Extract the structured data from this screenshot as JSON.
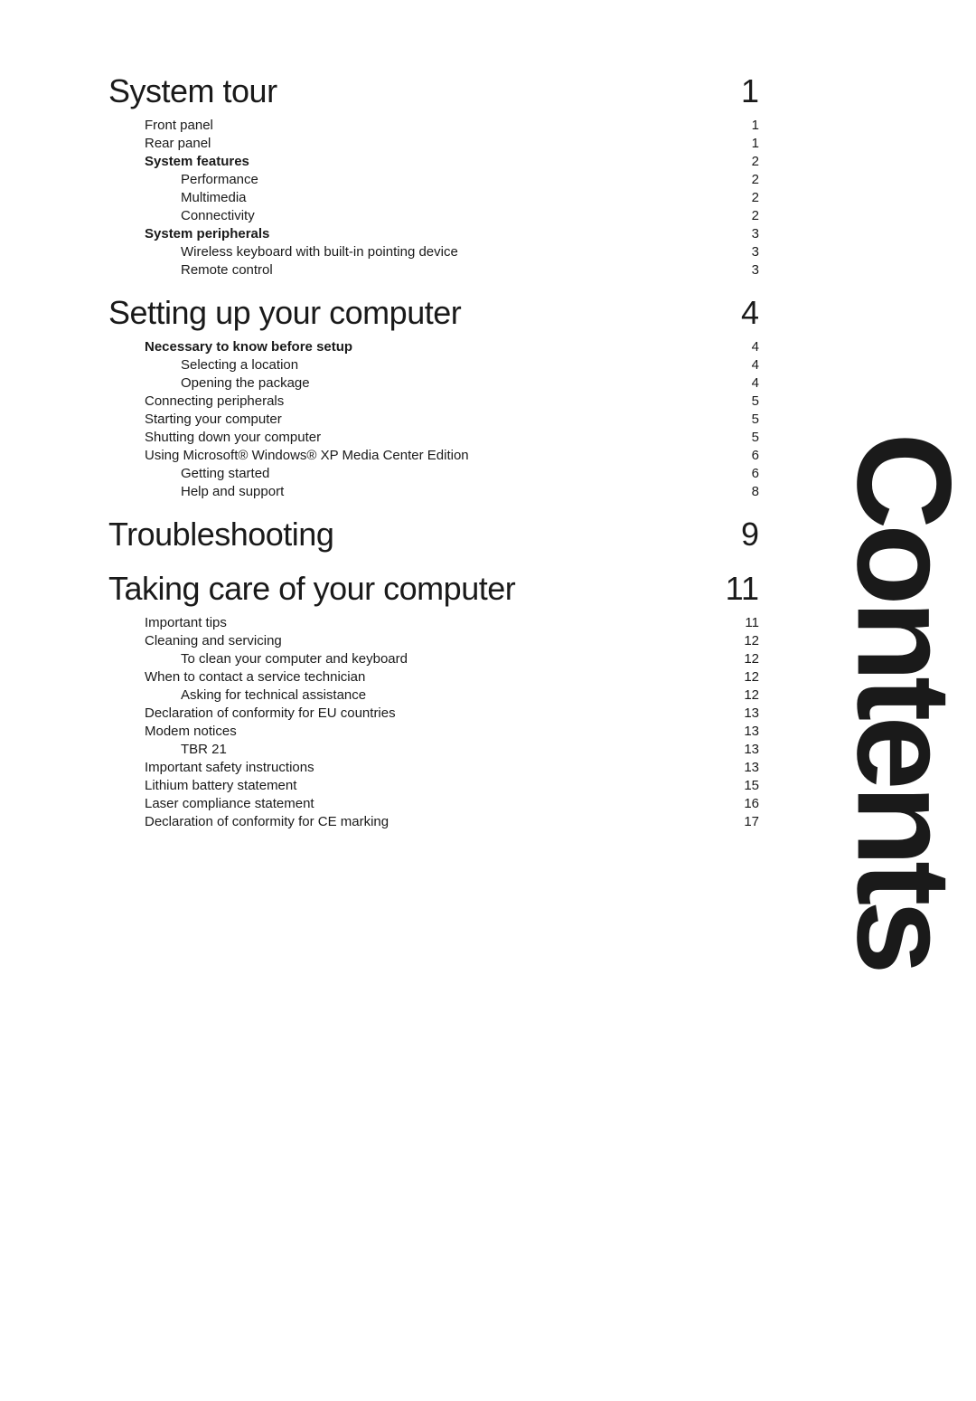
{
  "sidebar": {
    "title": "Contents"
  },
  "sections": [
    {
      "id": "system-tour",
      "title": "System tour",
      "page": "1",
      "entries": [
        {
          "label": "Front panel",
          "page": "1",
          "indent": 1,
          "bold": false
        },
        {
          "label": "Rear panel",
          "page": "1",
          "indent": 1,
          "bold": false
        },
        {
          "label": "System features",
          "page": "2",
          "indent": 1,
          "bold": true
        },
        {
          "label": "Performance",
          "page": "2",
          "indent": 2,
          "bold": false
        },
        {
          "label": "Multimedia",
          "page": "2",
          "indent": 2,
          "bold": false
        },
        {
          "label": "Connectivity",
          "page": "2",
          "indent": 2,
          "bold": false
        },
        {
          "label": "System peripherals",
          "page": "3",
          "indent": 1,
          "bold": true
        },
        {
          "label": "Wireless keyboard with built-in pointing device",
          "page": "3",
          "indent": 2,
          "bold": false
        },
        {
          "label": "Remote control",
          "page": "3",
          "indent": 2,
          "bold": false
        }
      ]
    },
    {
      "id": "setting-up",
      "title": "Setting up your computer",
      "page": "4",
      "entries": [
        {
          "label": "Necessary to know before setup",
          "page": "4",
          "indent": 1,
          "bold": true
        },
        {
          "label": "Selecting a location",
          "page": "4",
          "indent": 2,
          "bold": false
        },
        {
          "label": "Opening the package",
          "page": "4",
          "indent": 2,
          "bold": false
        },
        {
          "label": "Connecting peripherals",
          "page": "5",
          "indent": 1,
          "bold": false
        },
        {
          "label": "Starting your computer",
          "page": "5",
          "indent": 1,
          "bold": false
        },
        {
          "label": "Shutting down your computer",
          "page": "5",
          "indent": 1,
          "bold": false
        },
        {
          "label": "Using Microsoft® Windows® XP Media Center Edition",
          "page": "6",
          "indent": 1,
          "bold": false
        },
        {
          "label": "Getting started",
          "page": "6",
          "indent": 2,
          "bold": false
        },
        {
          "label": "Help and support",
          "page": "8",
          "indent": 2,
          "bold": false
        }
      ]
    },
    {
      "id": "troubleshooting",
      "title": "Troubleshooting",
      "page": "9",
      "entries": []
    },
    {
      "id": "taking-care",
      "title": "Taking care of your computer",
      "page": "11",
      "entries": [
        {
          "label": "Important tips",
          "page": "11",
          "indent": 1,
          "bold": false
        },
        {
          "label": "Cleaning and servicing",
          "page": "12",
          "indent": 1,
          "bold": false
        },
        {
          "label": "To clean your computer and keyboard",
          "page": "12",
          "indent": 2,
          "bold": false
        },
        {
          "label": "When to contact a service technician",
          "page": "12",
          "indent": 1,
          "bold": false
        },
        {
          "label": "Asking for technical assistance",
          "page": "12",
          "indent": 2,
          "bold": false
        },
        {
          "label": "Declaration of conformity for EU countries",
          "page": "13",
          "indent": 1,
          "bold": false
        },
        {
          "label": "Modem notices",
          "page": "13",
          "indent": 1,
          "bold": false
        },
        {
          "label": "TBR 21",
          "page": "13",
          "indent": 2,
          "bold": false
        },
        {
          "label": "Important safety instructions",
          "page": "13",
          "indent": 1,
          "bold": false
        },
        {
          "label": "Lithium battery statement",
          "page": "15",
          "indent": 1,
          "bold": false
        },
        {
          "label": "Laser compliance statement",
          "page": "16",
          "indent": 1,
          "bold": false
        },
        {
          "label": "Declaration of conformity for CE marking",
          "page": "17",
          "indent": 1,
          "bold": false
        }
      ]
    }
  ]
}
